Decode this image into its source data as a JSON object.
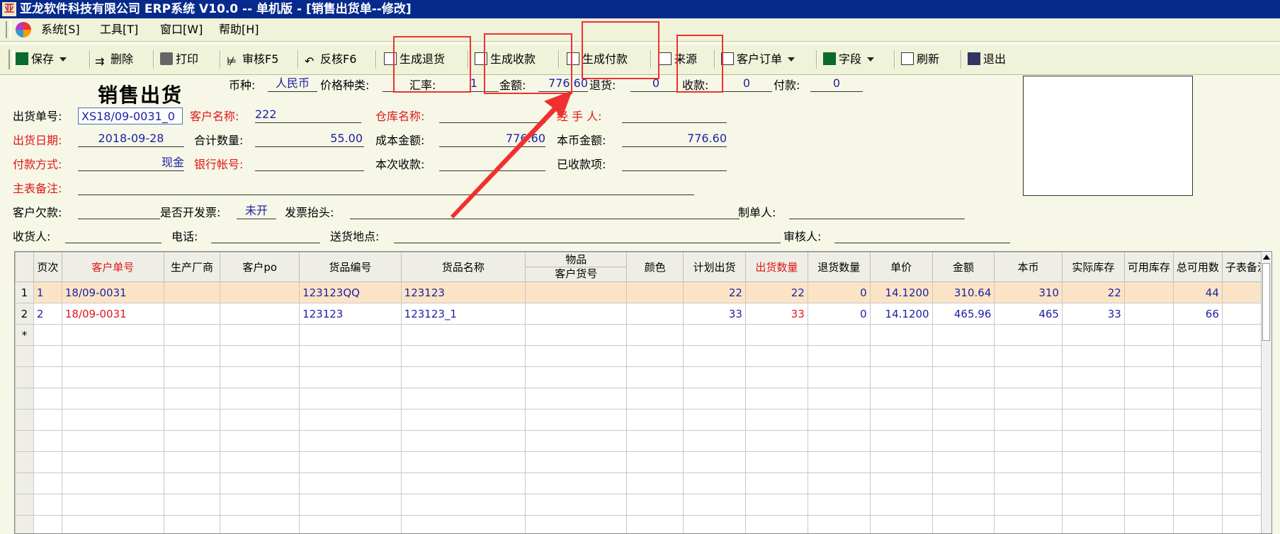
{
  "window": {
    "title": "亚龙软件科技有限公司 ERP系统 V10.0 -- 单机版 - [销售出货单--修改]",
    "app_icon": "亚"
  },
  "menu": {
    "items": [
      "系统[S]",
      "工具[T]",
      "窗口[W]",
      "帮助[H]"
    ]
  },
  "toolbar": {
    "save": "保存",
    "delete": "删除",
    "print": "打印",
    "audit": "审核F5",
    "unaudit": "反核F6",
    "gen_return": "生成退货",
    "gen_receipt": "生成收款",
    "gen_payment": "生成付款",
    "source": "来源",
    "customer_order": "客户订单",
    "fields": "字段",
    "refresh": "刷新",
    "exit": "退出"
  },
  "form": {
    "title": "销售出货",
    "currency_label": "币种:",
    "currency": "人民币",
    "price_type_label": "价格种类:",
    "price_type": "",
    "rate_label": "汇率:",
    "rate": "1",
    "amount_label": "金额:",
    "amount": "776.60",
    "return_label": "退货:",
    "return_value": "0",
    "receipt_label": "收款:",
    "receipt_value": "0",
    "payment_label": "付款:",
    "payment_value": "0",
    "order_no_label": "出货单号:",
    "order_no": "XS18/09-0031_0",
    "customer_label": "客户名称:",
    "customer": "222",
    "warehouse_label": "仓库名称:",
    "warehouse": "",
    "handler_label": "经 手 人:",
    "handler": "",
    "date_label": "出货日期:",
    "date": "2018-09-28",
    "total_qty_label": "合计数量:",
    "total_qty": "55.00",
    "cost_label": "成本金额:",
    "cost": "776.60",
    "local_amount_label": "本币金额:",
    "local_amount": "776.60",
    "pay_method_label": "付款方式:",
    "pay_method": "现金",
    "bank_label": "银行帐号:",
    "bank": "",
    "this_receipt_label": "本次收款:",
    "this_receipt": "",
    "received_label": "已收款项:",
    "received": "",
    "remark_label": "主表备注:",
    "remark": "",
    "debt_label": "客户欠款:",
    "debt": "",
    "invoice_label": "是否开发票:",
    "invoice": "未开",
    "invoice_title_label": "发票抬头:",
    "invoice_title": "",
    "maker_label": "制单人:",
    "maker": "",
    "receiver_label": "收货人:",
    "receiver": "",
    "phone_label": "电话:",
    "phone": "",
    "address_label": "送货地点:",
    "address": "",
    "auditor_label": "审核人:",
    "auditor": ""
  },
  "grid": {
    "headers": [
      "页次",
      "客户单号",
      "生产厂商",
      "客户po",
      "货品编号",
      "货品名称",
      "物品",
      "客户货号",
      "颜色",
      "计划出货",
      "出货数量",
      "退货数量",
      "单价",
      "金额",
      "本币",
      "实际库存",
      "可用库存",
      "总可用数",
      "子表备注"
    ],
    "rows": [
      {
        "idx": "1",
        "page": "1",
        "cust_order": "18/09-0031",
        "maker": "",
        "po": "",
        "code": "123123QQ",
        "name": "123123",
        "cust_item": "",
        "color": "",
        "plan": "22",
        "qty": "22",
        "ret": "0",
        "price": "14.1200",
        "amount": "310.64",
        "local": "310",
        "stock": "22",
        "avail": "",
        "total_avail": "44",
        "remark": ""
      },
      {
        "idx": "2",
        "page": "2",
        "cust_order": "18/09-0031",
        "maker": "",
        "po": "",
        "code": "123123",
        "name": "123123_1",
        "cust_item": "",
        "color": "",
        "plan": "33",
        "qty": "33",
        "ret": "0",
        "price": "14.1200",
        "amount": "465.96",
        "local": "465",
        "stock": "33",
        "avail": "",
        "total_avail": "66",
        "remark": ""
      }
    ],
    "new_row_marker": "*"
  },
  "colors": {
    "title_bar": "#062a8c",
    "highlight": "#f03030",
    "selected_row": "#fbe4c6",
    "value_text": "#1b1fa6",
    "required_label": "#e0161b"
  }
}
